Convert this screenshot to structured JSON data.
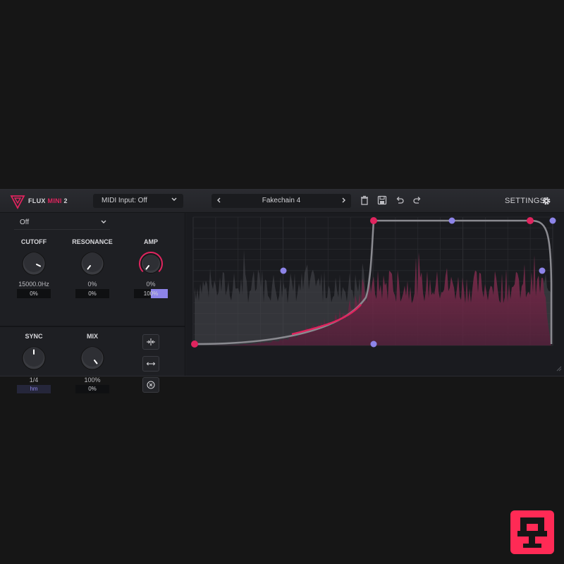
{
  "header": {
    "brand": {
      "part1": "FLUX",
      "part2": "MINI",
      "part3": "2"
    },
    "midi_input": "MIDI Input: Off",
    "preset_name": "Fakechain 4",
    "settings_label": "SETTINGS"
  },
  "left_panel": {
    "mode_dropdown": "Off",
    "cutoff": {
      "label": "CUTOFF",
      "value": "15000.0Hz",
      "field": "0%"
    },
    "resonance": {
      "label": "RESONANCE",
      "value": "0%",
      "field": "0%"
    },
    "amp": {
      "label": "AMP",
      "value": "0%",
      "field": "100%"
    },
    "sync": {
      "label": "SYNC",
      "value": "1/4",
      "field": "hm"
    },
    "mix": {
      "label": "MIX",
      "value": "100%",
      "field": "0%"
    }
  },
  "colors": {
    "accent": "#e0245e",
    "secondary": "#8d84e8",
    "background": "#1e1f23"
  }
}
